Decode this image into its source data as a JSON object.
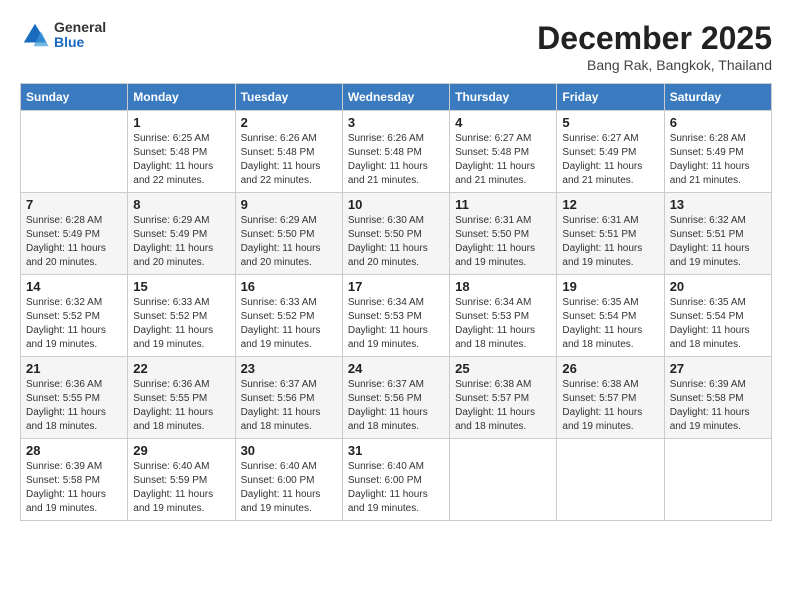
{
  "logo": {
    "general": "General",
    "blue": "Blue"
  },
  "header": {
    "month": "December 2025",
    "location": "Bang Rak, Bangkok, Thailand"
  },
  "days_of_week": [
    "Sunday",
    "Monday",
    "Tuesday",
    "Wednesday",
    "Thursday",
    "Friday",
    "Saturday"
  ],
  "weeks": [
    [
      {
        "day": "",
        "sunrise": "",
        "sunset": "",
        "daylight": ""
      },
      {
        "day": "1",
        "sunrise": "Sunrise: 6:25 AM",
        "sunset": "Sunset: 5:48 PM",
        "daylight": "Daylight: 11 hours and 22 minutes."
      },
      {
        "day": "2",
        "sunrise": "Sunrise: 6:26 AM",
        "sunset": "Sunset: 5:48 PM",
        "daylight": "Daylight: 11 hours and 22 minutes."
      },
      {
        "day": "3",
        "sunrise": "Sunrise: 6:26 AM",
        "sunset": "Sunset: 5:48 PM",
        "daylight": "Daylight: 11 hours and 21 minutes."
      },
      {
        "day": "4",
        "sunrise": "Sunrise: 6:27 AM",
        "sunset": "Sunset: 5:48 PM",
        "daylight": "Daylight: 11 hours and 21 minutes."
      },
      {
        "day": "5",
        "sunrise": "Sunrise: 6:27 AM",
        "sunset": "Sunset: 5:49 PM",
        "daylight": "Daylight: 11 hours and 21 minutes."
      },
      {
        "day": "6",
        "sunrise": "Sunrise: 6:28 AM",
        "sunset": "Sunset: 5:49 PM",
        "daylight": "Daylight: 11 hours and 21 minutes."
      }
    ],
    [
      {
        "day": "7",
        "sunrise": "Sunrise: 6:28 AM",
        "sunset": "Sunset: 5:49 PM",
        "daylight": "Daylight: 11 hours and 20 minutes."
      },
      {
        "day": "8",
        "sunrise": "Sunrise: 6:29 AM",
        "sunset": "Sunset: 5:49 PM",
        "daylight": "Daylight: 11 hours and 20 minutes."
      },
      {
        "day": "9",
        "sunrise": "Sunrise: 6:29 AM",
        "sunset": "Sunset: 5:50 PM",
        "daylight": "Daylight: 11 hours and 20 minutes."
      },
      {
        "day": "10",
        "sunrise": "Sunrise: 6:30 AM",
        "sunset": "Sunset: 5:50 PM",
        "daylight": "Daylight: 11 hours and 20 minutes."
      },
      {
        "day": "11",
        "sunrise": "Sunrise: 6:31 AM",
        "sunset": "Sunset: 5:50 PM",
        "daylight": "Daylight: 11 hours and 19 minutes."
      },
      {
        "day": "12",
        "sunrise": "Sunrise: 6:31 AM",
        "sunset": "Sunset: 5:51 PM",
        "daylight": "Daylight: 11 hours and 19 minutes."
      },
      {
        "day": "13",
        "sunrise": "Sunrise: 6:32 AM",
        "sunset": "Sunset: 5:51 PM",
        "daylight": "Daylight: 11 hours and 19 minutes."
      }
    ],
    [
      {
        "day": "14",
        "sunrise": "Sunrise: 6:32 AM",
        "sunset": "Sunset: 5:52 PM",
        "daylight": "Daylight: 11 hours and 19 minutes."
      },
      {
        "day": "15",
        "sunrise": "Sunrise: 6:33 AM",
        "sunset": "Sunset: 5:52 PM",
        "daylight": "Daylight: 11 hours and 19 minutes."
      },
      {
        "day": "16",
        "sunrise": "Sunrise: 6:33 AM",
        "sunset": "Sunset: 5:52 PM",
        "daylight": "Daylight: 11 hours and 19 minutes."
      },
      {
        "day": "17",
        "sunrise": "Sunrise: 6:34 AM",
        "sunset": "Sunset: 5:53 PM",
        "daylight": "Daylight: 11 hours and 19 minutes."
      },
      {
        "day": "18",
        "sunrise": "Sunrise: 6:34 AM",
        "sunset": "Sunset: 5:53 PM",
        "daylight": "Daylight: 11 hours and 18 minutes."
      },
      {
        "day": "19",
        "sunrise": "Sunrise: 6:35 AM",
        "sunset": "Sunset: 5:54 PM",
        "daylight": "Daylight: 11 hours and 18 minutes."
      },
      {
        "day": "20",
        "sunrise": "Sunrise: 6:35 AM",
        "sunset": "Sunset: 5:54 PM",
        "daylight": "Daylight: 11 hours and 18 minutes."
      }
    ],
    [
      {
        "day": "21",
        "sunrise": "Sunrise: 6:36 AM",
        "sunset": "Sunset: 5:55 PM",
        "daylight": "Daylight: 11 hours and 18 minutes."
      },
      {
        "day": "22",
        "sunrise": "Sunrise: 6:36 AM",
        "sunset": "Sunset: 5:55 PM",
        "daylight": "Daylight: 11 hours and 18 minutes."
      },
      {
        "day": "23",
        "sunrise": "Sunrise: 6:37 AM",
        "sunset": "Sunset: 5:56 PM",
        "daylight": "Daylight: 11 hours and 18 minutes."
      },
      {
        "day": "24",
        "sunrise": "Sunrise: 6:37 AM",
        "sunset": "Sunset: 5:56 PM",
        "daylight": "Daylight: 11 hours and 18 minutes."
      },
      {
        "day": "25",
        "sunrise": "Sunrise: 6:38 AM",
        "sunset": "Sunset: 5:57 PM",
        "daylight": "Daylight: 11 hours and 18 minutes."
      },
      {
        "day": "26",
        "sunrise": "Sunrise: 6:38 AM",
        "sunset": "Sunset: 5:57 PM",
        "daylight": "Daylight: 11 hours and 19 minutes."
      },
      {
        "day": "27",
        "sunrise": "Sunrise: 6:39 AM",
        "sunset": "Sunset: 5:58 PM",
        "daylight": "Daylight: 11 hours and 19 minutes."
      }
    ],
    [
      {
        "day": "28",
        "sunrise": "Sunrise: 6:39 AM",
        "sunset": "Sunset: 5:58 PM",
        "daylight": "Daylight: 11 hours and 19 minutes."
      },
      {
        "day": "29",
        "sunrise": "Sunrise: 6:40 AM",
        "sunset": "Sunset: 5:59 PM",
        "daylight": "Daylight: 11 hours and 19 minutes."
      },
      {
        "day": "30",
        "sunrise": "Sunrise: 6:40 AM",
        "sunset": "Sunset: 6:00 PM",
        "daylight": "Daylight: 11 hours and 19 minutes."
      },
      {
        "day": "31",
        "sunrise": "Sunrise: 6:40 AM",
        "sunset": "Sunset: 6:00 PM",
        "daylight": "Daylight: 11 hours and 19 minutes."
      },
      {
        "day": "",
        "sunrise": "",
        "sunset": "",
        "daylight": ""
      },
      {
        "day": "",
        "sunrise": "",
        "sunset": "",
        "daylight": ""
      },
      {
        "day": "",
        "sunrise": "",
        "sunset": "",
        "daylight": ""
      }
    ]
  ]
}
